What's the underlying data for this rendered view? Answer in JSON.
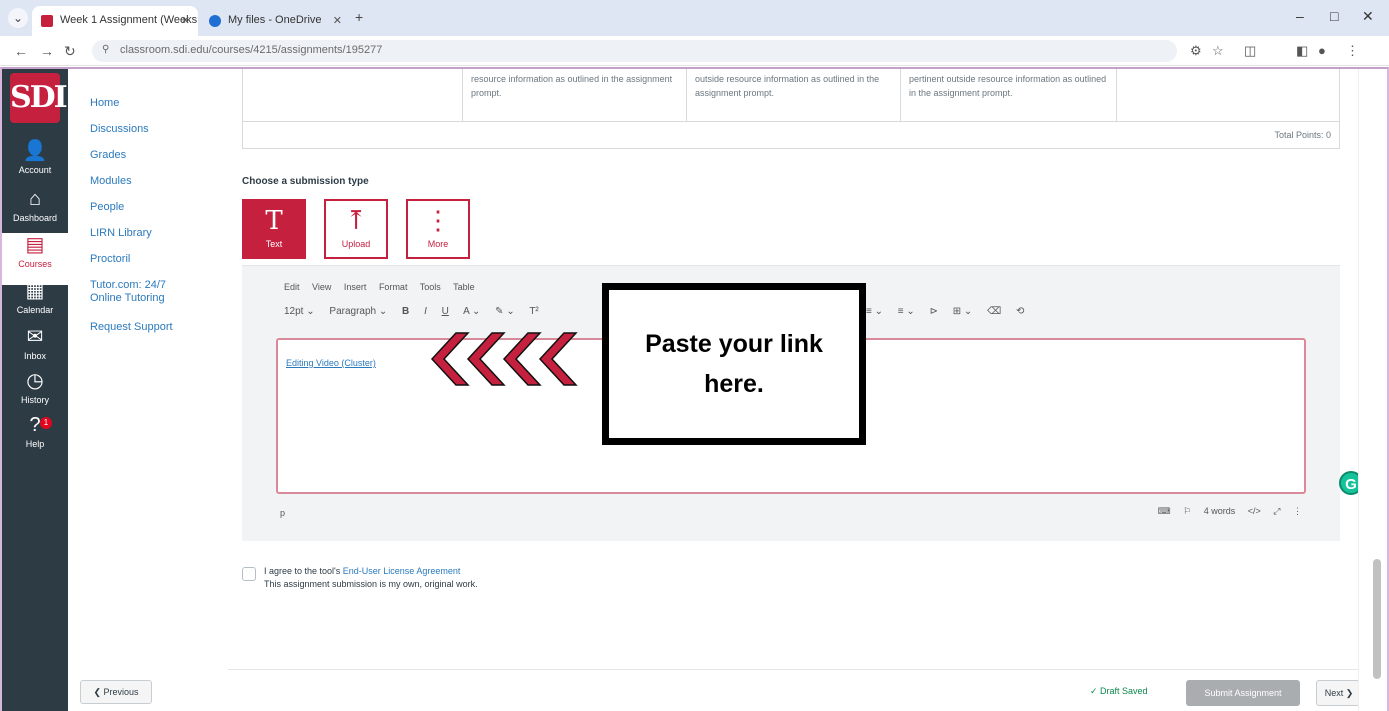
{
  "browser": {
    "tabs": [
      {
        "label": "Week 1 Assignment (Weeks",
        "active": true
      },
      {
        "label": "My files - OneDrive",
        "active": false
      }
    ],
    "new_tab": "+",
    "window_controls": [
      "–",
      "□",
      "✕"
    ],
    "url": "classroom.sdi.edu/courses/4215/assignments/195277"
  },
  "global_nav": {
    "logo": "SDI",
    "items": [
      {
        "label": "Account",
        "icon": "account-icon",
        "glyph": "👤"
      },
      {
        "label": "Dashboard",
        "icon": "dashboard-icon",
        "glyph": "⌂"
      },
      {
        "label": "Courses",
        "icon": "courses-icon",
        "glyph": "▤"
      },
      {
        "label": "Calendar",
        "icon": "calendar-icon",
        "glyph": "▦"
      },
      {
        "label": "Inbox",
        "icon": "inbox-icon",
        "glyph": "✉"
      },
      {
        "label": "History",
        "icon": "history-icon",
        "glyph": "◷"
      },
      {
        "label": "Help",
        "icon": "help-icon",
        "glyph": "?",
        "badge": "1"
      }
    ]
  },
  "course_nav": {
    "items": [
      "Home",
      "Discussions",
      "Grades",
      "Modules",
      "People",
      "LIRN Library",
      "Proctoril",
      "Tutor.com: 24/7 Online Tutoring",
      "Request Support"
    ]
  },
  "rubric": {
    "cells": [
      "resource information as outlined in the assignment prompt.",
      "outside resource information as outlined in the assignment prompt.",
      "pertinent outside resource information as outlined in the assignment prompt."
    ],
    "total_points": "Total Points: 0"
  },
  "submission": {
    "heading": "Choose a submission type",
    "types": [
      {
        "label": "Text",
        "glyph": "T",
        "active": true
      },
      {
        "label": "Upload",
        "glyph": "⤒",
        "active": false
      },
      {
        "label": "More",
        "glyph": "⋮",
        "active": false
      }
    ]
  },
  "editor": {
    "menu": [
      "Edit",
      "View",
      "Insert",
      "Format",
      "Tools",
      "Table"
    ],
    "font_size": "12pt ⌄",
    "paragraph": "Paragraph ⌄",
    "format_buttons": [
      "B",
      "I",
      "U",
      "A ⌄",
      "✎ ⌄",
      "T²"
    ],
    "right_buttons": [
      "≡ ⌄",
      "≡ ⌄",
      "⊳",
      "⊞ ⌄",
      "⌫",
      "⟲"
    ],
    "link_text": "Editing Video (Cluster)",
    "status_p": "p",
    "word_count": "4 words",
    "html_toggle": "</>",
    "expand": "⤢",
    "more": "⋮",
    "a11y_icon": "⚐",
    "keyboard_icon": "⌨"
  },
  "callout": {
    "text": "Paste your link here."
  },
  "agreement": {
    "prefix": "I agree to the tool's ",
    "link": "End-User License Agreement",
    "line2": "This assignment submission is my own, original work."
  },
  "footer": {
    "previous": "❮ Previous",
    "draft": "✓ Draft Saved",
    "submit": "Submit Assignment",
    "next": "Next ❯"
  },
  "grammarly": "G",
  "colors": {
    "brand": "#c6203f",
    "nav_bg": "#2d3b45",
    "link": "#2b7abc",
    "draft": "#0b874b"
  }
}
